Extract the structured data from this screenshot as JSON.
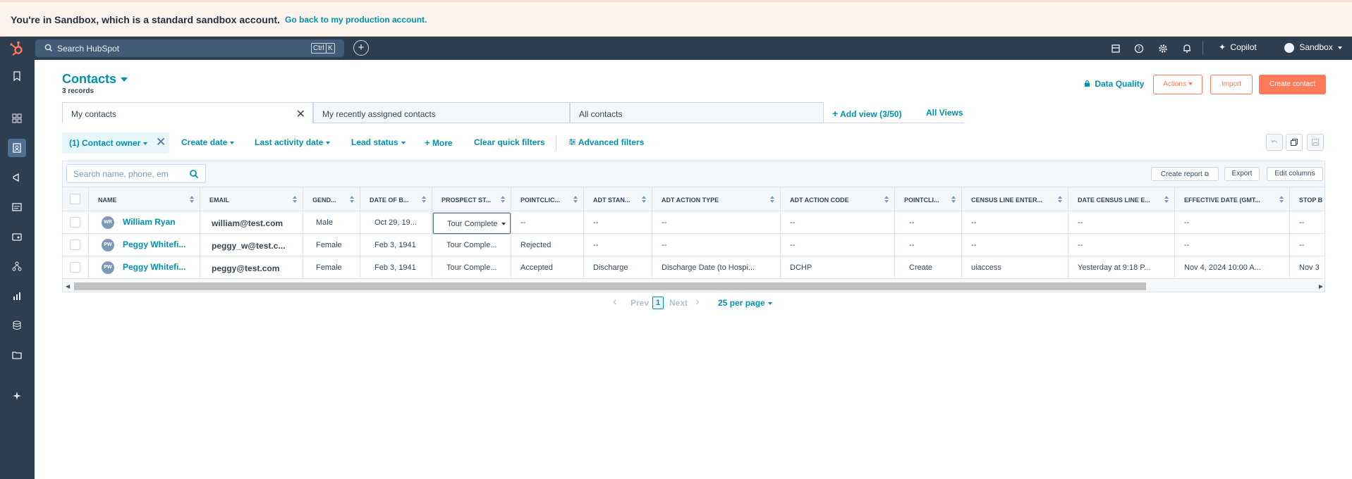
{
  "banner": {
    "text": "You're in Sandbox, which is a standard sandbox account.",
    "link": "Go back to my production account."
  },
  "topbar": {
    "search_placeholder": "Search HubSpot",
    "shortcut_ctrl": "Ctrl",
    "shortcut_key": "K",
    "add_label": "+",
    "copilot_label": "Copilot",
    "account_label": "Sandbox",
    "icons": [
      "marketplace-icon",
      "help-icon",
      "settings-icon",
      "notifications-icon"
    ]
  },
  "sidebar": {
    "items": [
      "bookmarks-icon",
      "workspaces-icon",
      "contacts-icon",
      "marketing-icon",
      "content-icon",
      "commerce-icon",
      "automations-icon",
      "reporting-icon",
      "data-management-icon",
      "library-icon",
      "breeze-icon"
    ],
    "active": "contacts-icon"
  },
  "header": {
    "title": "Contacts",
    "record_count": "3 records",
    "data_quality": "Data Quality",
    "actions": "Actions",
    "import": "Import",
    "create": "Create contact"
  },
  "tabs": [
    {
      "label": "My contacts",
      "active": true
    },
    {
      "label": "My recently assigned contacts",
      "active": false
    },
    {
      "label": "All contacts",
      "active": false
    }
  ],
  "views": {
    "add_view": "Add view (3/50)",
    "all_views": "All Views"
  },
  "filters": {
    "owner": "(1) Contact owner",
    "create_date": "Create date",
    "last_activity": "Last activity date",
    "lead_status": "Lead status",
    "more": "More",
    "clear": "Clear quick filters",
    "advanced": "Advanced filters"
  },
  "table_bar": {
    "search_placeholder": "Search name, phone, em",
    "create_report": "Create report",
    "export": "Export",
    "edit_columns": "Edit columns"
  },
  "columns": [
    "NAME",
    "EMAIL",
    "GEND...",
    "DATE OF B...",
    "PROSPECT ST...",
    "POINTCLIC...",
    "ADT STAN...",
    "ADT ACTION TYPE",
    "ADT ACTION CODE",
    "POINTCLI...",
    "CENSUS LINE ENTER...",
    "DATE CENSUS LINE E...",
    "EFFECTIVE DATE (GMT...",
    "STOP B"
  ],
  "rows": [
    {
      "initials": "WR",
      "name": "William Ryan",
      "email": "william@test.com",
      "gender": "Male",
      "dob": "Oct 29, 19...",
      "prospect": "Tour Complete",
      "pointclick": "--",
      "adt_stan": "--",
      "adt_type": "--",
      "adt_code": "--",
      "pointcli": "--",
      "census": "--",
      "census_date": "--",
      "effective": "--",
      "stop": "--"
    },
    {
      "initials": "PW",
      "name": "Peggy Whitefi...",
      "email": "peggy_w@test.c...",
      "gender": "Female",
      "dob": "Feb 3, 1941",
      "prospect": "Tour Comple...",
      "pointclick": "Rejected",
      "adt_stan": "--",
      "adt_type": "--",
      "adt_code": "--",
      "pointcli": "--",
      "census": "--",
      "census_date": "--",
      "effective": "--",
      "stop": "--"
    },
    {
      "initials": "PW",
      "name": "Peggy Whitefi...",
      "email": "peggy@test.com",
      "gender": "Female",
      "dob": "Feb 3, 1941",
      "prospect": "Tour Comple...",
      "pointclick": "Accepted",
      "adt_stan": "Discharge",
      "adt_type": "Discharge Date (to Hospi...",
      "adt_code": "DCHP",
      "pointcli": "Create",
      "census": "uiaccess",
      "census_date": "Yesterday at 9:18 P...",
      "effective": "Nov 4, 2024 10:00 A...",
      "stop": "Nov 3"
    }
  ],
  "pager": {
    "prev": "Prev",
    "page": "1",
    "next": "Next",
    "per_page": "25 per page"
  },
  "colors": {
    "accent": "#0091ae",
    "brand": "#ff7a59",
    "nav": "#2d3e50"
  }
}
